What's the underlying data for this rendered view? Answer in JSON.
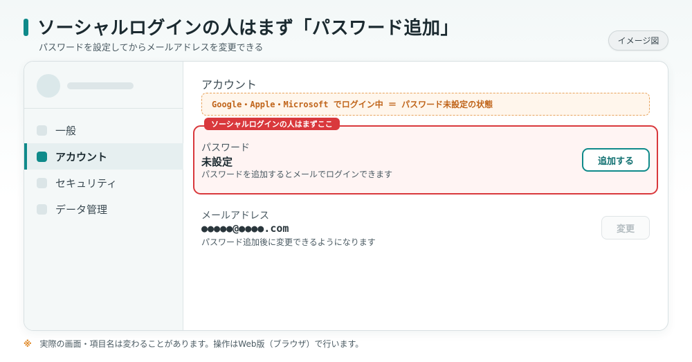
{
  "header": {
    "title": "ソーシャルログインの人はまず「パスワード追加」",
    "subtitle": "パスワードを設定してからメールアドレスを変更できる",
    "badge": "イメージ図"
  },
  "sidebar": {
    "items": [
      {
        "label": "一般"
      },
      {
        "label": "アカウント"
      },
      {
        "label": "セキュリティ"
      },
      {
        "label": "データ管理"
      }
    ]
  },
  "main": {
    "section_title": "アカウント",
    "notice": "Google・Apple・Microsoft でログイン中 ＝ パスワード未設定の状態",
    "highlight_tag": "ソーシャルログインの人はまずここ",
    "password": {
      "label": "パスワード",
      "value": "未設定",
      "description": "パスワードを追加するとメールでログインできます",
      "button": "追加する"
    },
    "email": {
      "label": "メールアドレス",
      "value": "●●●●●@●●●●.com",
      "description": "パスワード追加後に変更できるようになります",
      "button": "変更"
    }
  },
  "footnote": {
    "mark": "※",
    "text": "実際の画面・項目名は変わることがあります。操作はWeb版（ブラウザ）で行います。"
  },
  "colors": {
    "accent": "#0f8a8a",
    "highlight": "#d9383c",
    "notice": "#e8a25a"
  }
}
